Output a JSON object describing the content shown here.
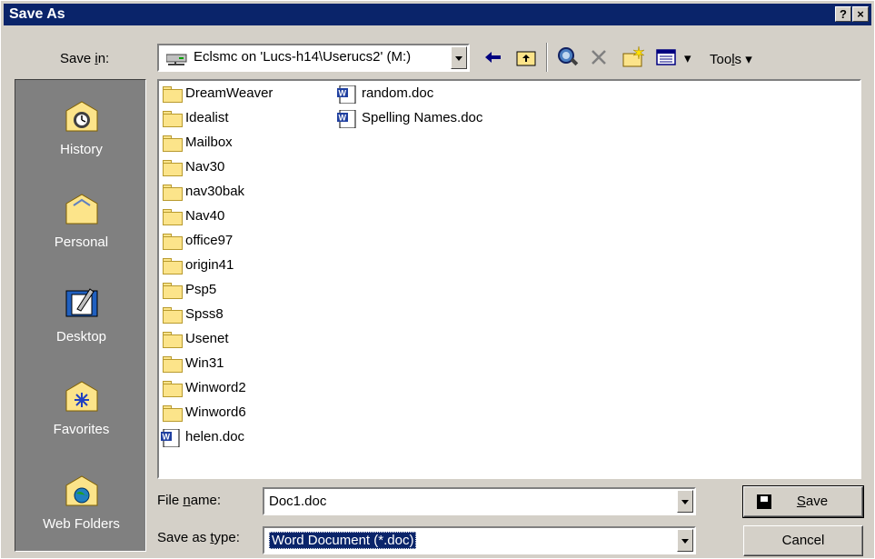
{
  "window": {
    "title": "Save As",
    "help_label": "?",
    "close_label": "×"
  },
  "toolbar": {
    "save_in_label_pre": "Save ",
    "save_in_label_u": "i",
    "save_in_label_post": "n:",
    "save_in_value": "Eclsmc on 'Lucs-h14\\Userucs2' (M:)",
    "tools_label_pre": "Too",
    "tools_label_u": "l",
    "tools_label_post": "s ▾",
    "views_caret": "▾",
    "icons": [
      "back-icon",
      "up-folder-icon",
      "search-web-icon",
      "delete-icon",
      "new-folder-icon",
      "views-icon"
    ]
  },
  "places": [
    {
      "label": "History",
      "icon": "history-icon"
    },
    {
      "label": "Personal",
      "icon": "personal-icon"
    },
    {
      "label": "Desktop",
      "icon": "desktop-icon"
    },
    {
      "label": "Favorites",
      "icon": "favorites-icon"
    },
    {
      "label": "Web Folders",
      "icon": "web-folders-icon"
    }
  ],
  "files": {
    "col1": [
      {
        "name": "DreamWeaver",
        "type": "folder"
      },
      {
        "name": "Idealist",
        "type": "folder"
      },
      {
        "name": "Mailbox",
        "type": "folder"
      },
      {
        "name": "Nav30",
        "type": "folder"
      },
      {
        "name": "nav30bak",
        "type": "folder"
      },
      {
        "name": "Nav40",
        "type": "folder"
      },
      {
        "name": "office97",
        "type": "folder"
      },
      {
        "name": "origin41",
        "type": "folder"
      },
      {
        "name": "Psp5",
        "type": "folder"
      },
      {
        "name": "Spss8",
        "type": "folder"
      },
      {
        "name": "Usenet",
        "type": "folder"
      },
      {
        "name": "Win31",
        "type": "folder"
      },
      {
        "name": "Winword2",
        "type": "folder"
      },
      {
        "name": "Winword6",
        "type": "folder"
      },
      {
        "name": "helen.doc",
        "type": "doc"
      }
    ],
    "col2": [
      {
        "name": "random.doc",
        "type": "doc"
      },
      {
        "name": "Spelling Names.doc",
        "type": "doc"
      }
    ]
  },
  "form": {
    "filename_label_pre": "File ",
    "filename_label_u": "n",
    "filename_label_post": "ame:",
    "filename_value": "Doc1.doc",
    "type_label_pre": "Save as ",
    "type_label_u": "t",
    "type_label_post": "ype:",
    "type_value": "Word Document (*.doc)"
  },
  "buttons": {
    "save_label_u": "S",
    "save_label_post": "ave",
    "cancel_label": "Cancel"
  }
}
